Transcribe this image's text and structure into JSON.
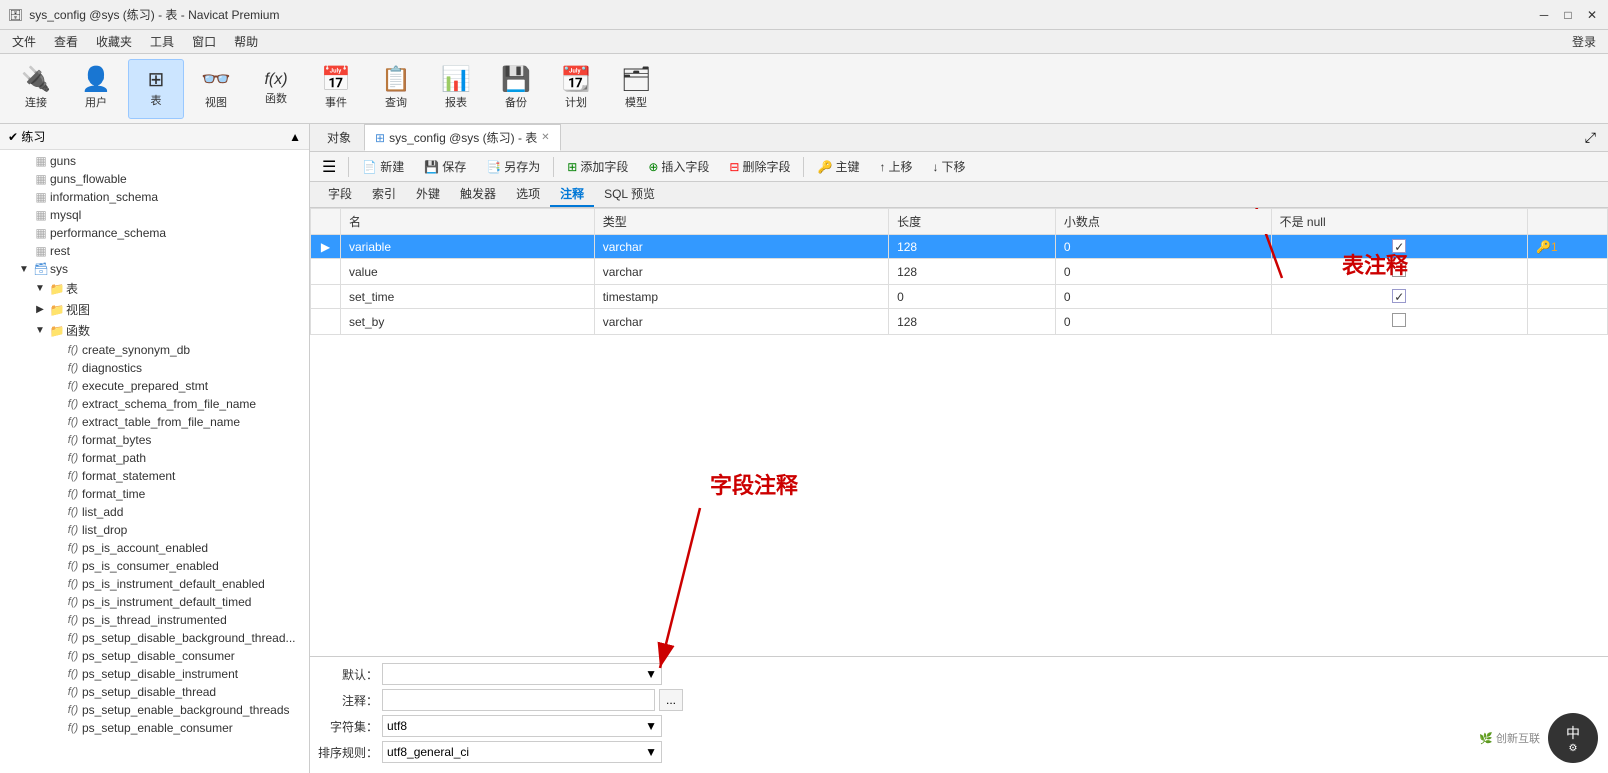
{
  "titleBar": {
    "title": "sys_config @sys (练习) - 表 - Navicat Premium",
    "minimize": "─",
    "maximize": "□",
    "close": "✕"
  },
  "menuBar": {
    "items": [
      "文件",
      "查看",
      "收藏夹",
      "工具",
      "窗口",
      "帮助"
    ],
    "loginLabel": "登录"
  },
  "toolbar": {
    "items": [
      {
        "id": "connect",
        "icon": "🔌",
        "label": "连接"
      },
      {
        "id": "user",
        "icon": "👤",
        "label": "用户"
      },
      {
        "id": "table",
        "icon": "⊞",
        "label": "表",
        "active": true
      },
      {
        "id": "view",
        "icon": "👓",
        "label": "视图"
      },
      {
        "id": "function",
        "icon": "f(x)",
        "label": "函数"
      },
      {
        "id": "event",
        "icon": "📅",
        "label": "事件"
      },
      {
        "id": "query",
        "icon": "📋",
        "label": "查询"
      },
      {
        "id": "report",
        "icon": "📊",
        "label": "报表"
      },
      {
        "id": "backup",
        "icon": "💾",
        "label": "备份"
      },
      {
        "id": "schedule",
        "icon": "📆",
        "label": "计划"
      },
      {
        "id": "model",
        "icon": "🗂",
        "label": "模型"
      }
    ]
  },
  "sidebar": {
    "headerLabel": "练习",
    "items": [
      {
        "id": "guns",
        "label": "guns",
        "indent": 1,
        "type": "table",
        "icon": "📋"
      },
      {
        "id": "guns_flowable",
        "label": "guns_flowable",
        "indent": 1,
        "type": "table",
        "icon": "📋"
      },
      {
        "id": "information_schema",
        "label": "information_schema",
        "indent": 1,
        "type": "table",
        "icon": "📋"
      },
      {
        "id": "mysql",
        "label": "mysql",
        "indent": 1,
        "type": "table",
        "icon": "📋"
      },
      {
        "id": "performance_schema",
        "label": "performance_schema",
        "indent": 1,
        "type": "table",
        "icon": "📋"
      },
      {
        "id": "rest",
        "label": "rest",
        "indent": 1,
        "type": "table",
        "icon": "📋"
      },
      {
        "id": "sys",
        "label": "sys",
        "indent": 1,
        "type": "db",
        "icon": "🗃",
        "expanded": true
      },
      {
        "id": "tables",
        "label": "表",
        "indent": 2,
        "type": "folder",
        "icon": "📁",
        "expanded": true
      },
      {
        "id": "views",
        "label": "视图",
        "indent": 2,
        "type": "folder",
        "icon": "📁"
      },
      {
        "id": "functions",
        "label": "函数",
        "indent": 2,
        "type": "folder",
        "icon": "📁",
        "expanded": true
      },
      {
        "id": "fn_create_synonym_db",
        "label": "create_synonym_db",
        "indent": 3,
        "type": "func",
        "icon": "f()"
      },
      {
        "id": "fn_diagnostics",
        "label": "diagnostics",
        "indent": 3,
        "type": "func",
        "icon": "f()"
      },
      {
        "id": "fn_execute_prepared_stmt",
        "label": "execute_prepared_stmt",
        "indent": 3,
        "type": "func",
        "icon": "f()"
      },
      {
        "id": "fn_extract_schema_from_file_name",
        "label": "extract_schema_from_file_name",
        "indent": 3,
        "type": "func",
        "icon": "f()"
      },
      {
        "id": "fn_extract_table_from_file_name",
        "label": "extract_table_from_file_name",
        "indent": 3,
        "type": "func",
        "icon": "f()"
      },
      {
        "id": "fn_format_bytes",
        "label": "format_bytes",
        "indent": 3,
        "type": "func",
        "icon": "f()"
      },
      {
        "id": "fn_format_path",
        "label": "format_path",
        "indent": 3,
        "type": "func",
        "icon": "f()"
      },
      {
        "id": "fn_format_statement",
        "label": "format_statement",
        "indent": 3,
        "type": "func",
        "icon": "f()"
      },
      {
        "id": "fn_format_time",
        "label": "format_time",
        "indent": 3,
        "type": "func",
        "icon": "f()",
        "selected": false
      },
      {
        "id": "fn_list_add",
        "label": "list_add",
        "indent": 3,
        "type": "func",
        "icon": "f()"
      },
      {
        "id": "fn_list_drop",
        "label": "list_drop",
        "indent": 3,
        "type": "func",
        "icon": "f()"
      },
      {
        "id": "fn_ps_is_account_enabled",
        "label": "ps_is_account_enabled",
        "indent": 3,
        "type": "func",
        "icon": "f()"
      },
      {
        "id": "fn_ps_is_consumer_enabled",
        "label": "ps_is_consumer_enabled",
        "indent": 3,
        "type": "func",
        "icon": "f()"
      },
      {
        "id": "fn_ps_is_instrument_default_enabled",
        "label": "ps_is_instrument_default_enabled",
        "indent": 3,
        "type": "func",
        "icon": "f()"
      },
      {
        "id": "fn_ps_is_instrument_default_timed",
        "label": "ps_is_instrument_default_timed",
        "indent": 3,
        "type": "func",
        "icon": "f()"
      },
      {
        "id": "fn_ps_is_thread_instrumented",
        "label": "ps_is_thread_instrumented",
        "indent": 3,
        "type": "func",
        "icon": "f()"
      },
      {
        "id": "fn_ps_setup_disable_background_threads",
        "label": "ps_setup_disable_background_threads",
        "indent": 3,
        "type": "func",
        "icon": "f()"
      },
      {
        "id": "fn_ps_setup_disable_consumer",
        "label": "ps_setup_disable_consumer",
        "indent": 3,
        "type": "func",
        "icon": "f()"
      },
      {
        "id": "fn_ps_setup_disable_instrument",
        "label": "ps_setup_disable_instrument",
        "indent": 3,
        "type": "func",
        "icon": "f()"
      },
      {
        "id": "fn_ps_setup_disable_thread",
        "label": "ps_setup_disable_thread",
        "indent": 3,
        "type": "func",
        "icon": "f()"
      },
      {
        "id": "fn_ps_setup_enable_background_threads",
        "label": "ps_setup_enable_background_threads",
        "indent": 3,
        "type": "func",
        "icon": "f()"
      },
      {
        "id": "fn_ps_enable_consumer",
        "label": "ps_setup_enable_consumer",
        "indent": 3,
        "type": "func",
        "icon": "f()"
      }
    ]
  },
  "tabs": {
    "objectTab": "对象",
    "activeTab": "sys_config @sys (练习) - 表",
    "expandIcon": "⤢"
  },
  "actionBar": {
    "newBtn": "新建",
    "saveBtn": "保存",
    "saveAsBtn": "另存为",
    "addFieldBtn": "添加字段",
    "insertFieldBtn": "插入字段",
    "deleteFieldBtn": "删除字段",
    "primaryKeyBtn": "主键",
    "upBtn": "上移",
    "downBtn": "下移"
  },
  "subTabs": {
    "items": [
      "字段",
      "索引",
      "外键",
      "触发器",
      "选项",
      "注释",
      "SQL 预览"
    ],
    "active": "注释"
  },
  "fieldsTable": {
    "columns": [
      "名",
      "类型",
      "长度",
      "小数点",
      "不是 null"
    ],
    "rows": [
      {
        "name": "variable",
        "type": "varchar",
        "length": "128",
        "decimal": "0",
        "notNull": true,
        "primaryKey": true,
        "selected": true
      },
      {
        "name": "value",
        "type": "varchar",
        "length": "128",
        "decimal": "0",
        "notNull": false
      },
      {
        "name": "set_time",
        "type": "timestamp",
        "length": "0",
        "decimal": "0",
        "notNull": true
      },
      {
        "name": "set_by",
        "type": "varchar",
        "length": "128",
        "decimal": "0",
        "notNull": false
      }
    ]
  },
  "bottomPanel": {
    "defaultLabel": "默认：",
    "commentLabel": "注释：",
    "charsetLabel": "字符集：",
    "collationLabel": "排序规则：",
    "charsetValue": "utf8",
    "collationValue": "utf8_general_ci"
  },
  "annotations": {
    "tableComment": "表注释",
    "fieldComment": "字段注释"
  },
  "watermark": {
    "text": "中",
    "gear": "⚙",
    "brandIcon": "🌿",
    "brandText": "创新互联"
  }
}
